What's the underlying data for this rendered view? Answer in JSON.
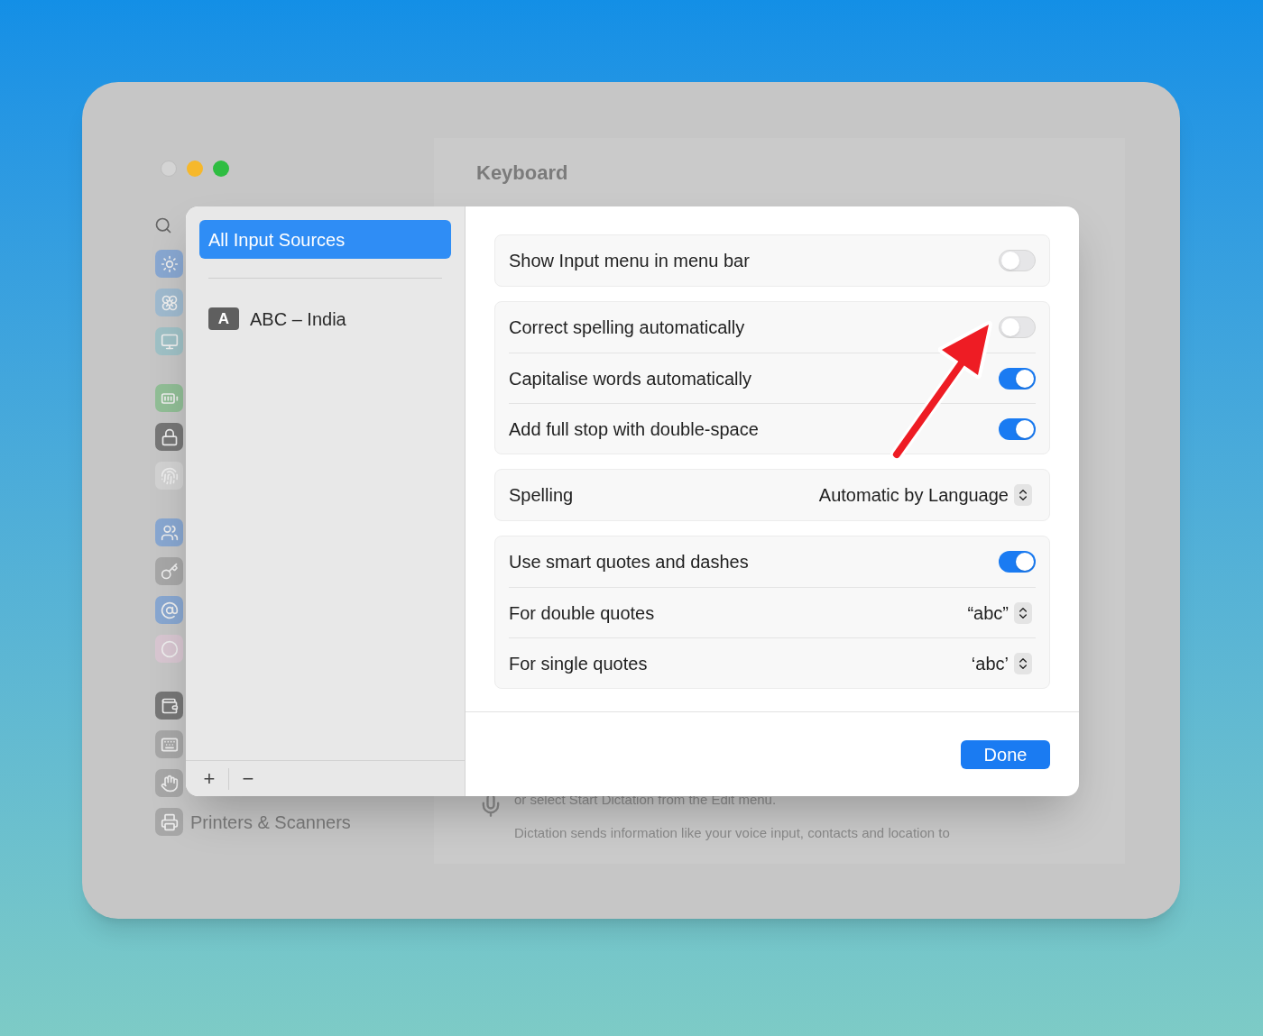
{
  "window": {
    "title": "Keyboard"
  },
  "sidebar_items": [
    {
      "label": "Printers & Scanners"
    }
  ],
  "dictation_lines": [
    "or select Start Dictation from the Edit menu.",
    "Dictation sends information like your voice input, contacts and location to"
  ],
  "sheet": {
    "sources": [
      {
        "label": "All Input Sources",
        "selected": true
      },
      {
        "label": "ABC – India",
        "badge": "A",
        "selected": false
      }
    ],
    "footer_buttons": [
      "+",
      "−"
    ],
    "groups": [
      [
        {
          "kind": "toggle",
          "label": "Show Input menu in menu bar",
          "on": false
        }
      ],
      [
        {
          "kind": "toggle",
          "label": "Correct spelling automatically",
          "on": false
        },
        {
          "kind": "toggle",
          "label": "Capitalise words automatically",
          "on": true
        },
        {
          "kind": "toggle",
          "label": "Add full stop with double-space",
          "on": true
        }
      ],
      [
        {
          "kind": "popup",
          "label": "Spelling",
          "value": "Automatic by Language"
        }
      ],
      [
        {
          "kind": "toggle",
          "label": "Use smart quotes and dashes",
          "on": true
        },
        {
          "kind": "popup",
          "label": "For double quotes",
          "value": "“abc”"
        },
        {
          "kind": "popup",
          "label": "For single quotes",
          "value": "‘abc’"
        }
      ]
    ],
    "done_button": "Done"
  }
}
